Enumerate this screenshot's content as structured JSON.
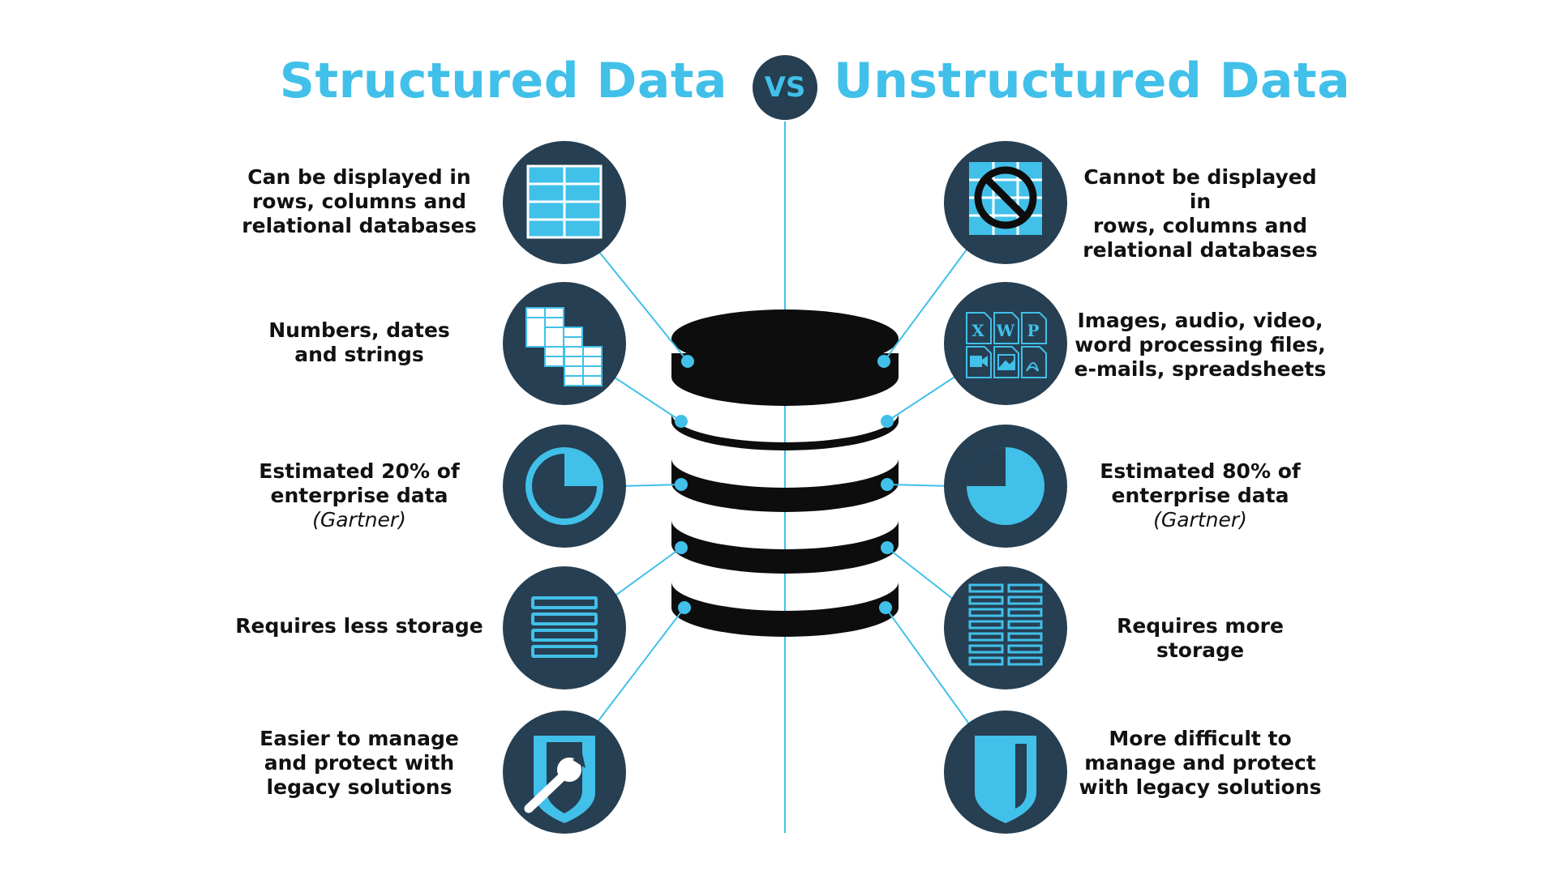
{
  "header": {
    "left_title": "Structured Data",
    "vs_label": "VS",
    "right_title": "Unstructured Data"
  },
  "colors": {
    "accent": "#41c0e9",
    "circle": "#263f52",
    "database": "#0d0d0d",
    "text": "#111111"
  },
  "structured": {
    "items": [
      {
        "icon": "table-grid-icon",
        "lines": [
          "Can be displayed in",
          "rows, columns and",
          "relational databases"
        ]
      },
      {
        "icon": "stacked-tables-icon",
        "lines": [
          "Numbers, dates",
          "and strings"
        ]
      },
      {
        "icon": "pie-chart-20-icon",
        "lines": [
          "Estimated 20% of",
          "enterprise data"
        ],
        "note": "(Gartner)"
      },
      {
        "icon": "storage-rows-few-icon",
        "lines": [
          "Requires less storage"
        ]
      },
      {
        "icon": "shield-wrench-icon",
        "lines": [
          "Easier to manage",
          "and protect with",
          "legacy solutions"
        ]
      }
    ]
  },
  "unstructured": {
    "items": [
      {
        "icon": "no-table-icon",
        "lines": [
          "Cannot be displayed in",
          "rows, columns and",
          "relational databases"
        ]
      },
      {
        "icon": "file-types-icon",
        "lines": [
          "Images, audio, video,",
          "word processing files,",
          "e-mails, spreadsheets"
        ]
      },
      {
        "icon": "pie-chart-80-icon",
        "lines": [
          "Estimated 80% of",
          "enterprise data"
        ],
        "note": "(Gartner)"
      },
      {
        "icon": "storage-rows-many-icon",
        "lines": [
          "Requires more storage"
        ]
      },
      {
        "icon": "shield-icon",
        "lines": [
          "More difficult to",
          "manage and protect",
          "with legacy solutions"
        ]
      }
    ]
  },
  "file_icons": [
    "X",
    "W",
    "P"
  ]
}
